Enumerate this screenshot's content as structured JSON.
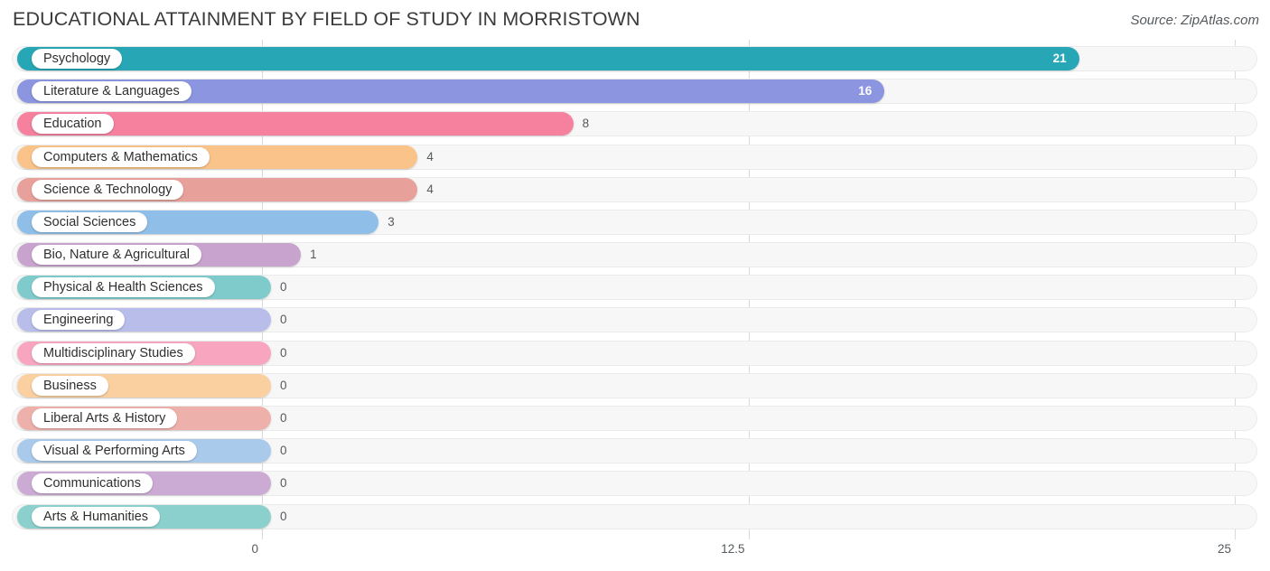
{
  "header": {
    "title": "EDUCATIONAL ATTAINMENT BY FIELD OF STUDY IN MORRISTOWN",
    "source": "Source: ZipAtlas.com"
  },
  "chart_data": {
    "type": "bar",
    "orientation": "horizontal",
    "title": "EDUCATIONAL ATTAINMENT BY FIELD OF STUDY IN MORRISTOWN",
    "xlabel": "",
    "ylabel": "",
    "xlim": [
      0,
      25
    ],
    "grid": true,
    "legend": "none",
    "ticks": [
      "0",
      "12.5",
      "25"
    ],
    "tick_values": [
      0,
      12.5,
      25
    ],
    "categories": [
      "Psychology",
      "Literature & Languages",
      "Education",
      "Computers & Mathematics",
      "Science & Technology",
      "Social Sciences",
      "Bio, Nature & Agricultural",
      "Physical & Health Sciences",
      "Engineering",
      "Multidisciplinary Studies",
      "Business",
      "Liberal Arts & History",
      "Visual & Performing Arts",
      "Communications",
      "Arts & Humanities"
    ],
    "values": [
      21,
      16,
      8,
      4,
      4,
      3,
      1,
      0,
      0,
      0,
      0,
      0,
      0,
      0,
      0
    ],
    "value_labels": [
      "21",
      "16",
      "8",
      "4",
      "4",
      "3",
      "1",
      "0",
      "0",
      "0",
      "0",
      "0",
      "0",
      "0",
      "0"
    ],
    "colors": [
      "#27a7b5",
      "#8b95e0",
      "#f5819f",
      "#f9c389",
      "#e8a09a",
      "#8fbfe8",
      "#c8a3ce",
      "#7fcbcb",
      "#b8bdea",
      "#f8a6c0",
      "#fbd0a0",
      "#eeb0ab",
      "#a9caea",
      "#cbabd4",
      "#8cd0ce"
    ]
  }
}
